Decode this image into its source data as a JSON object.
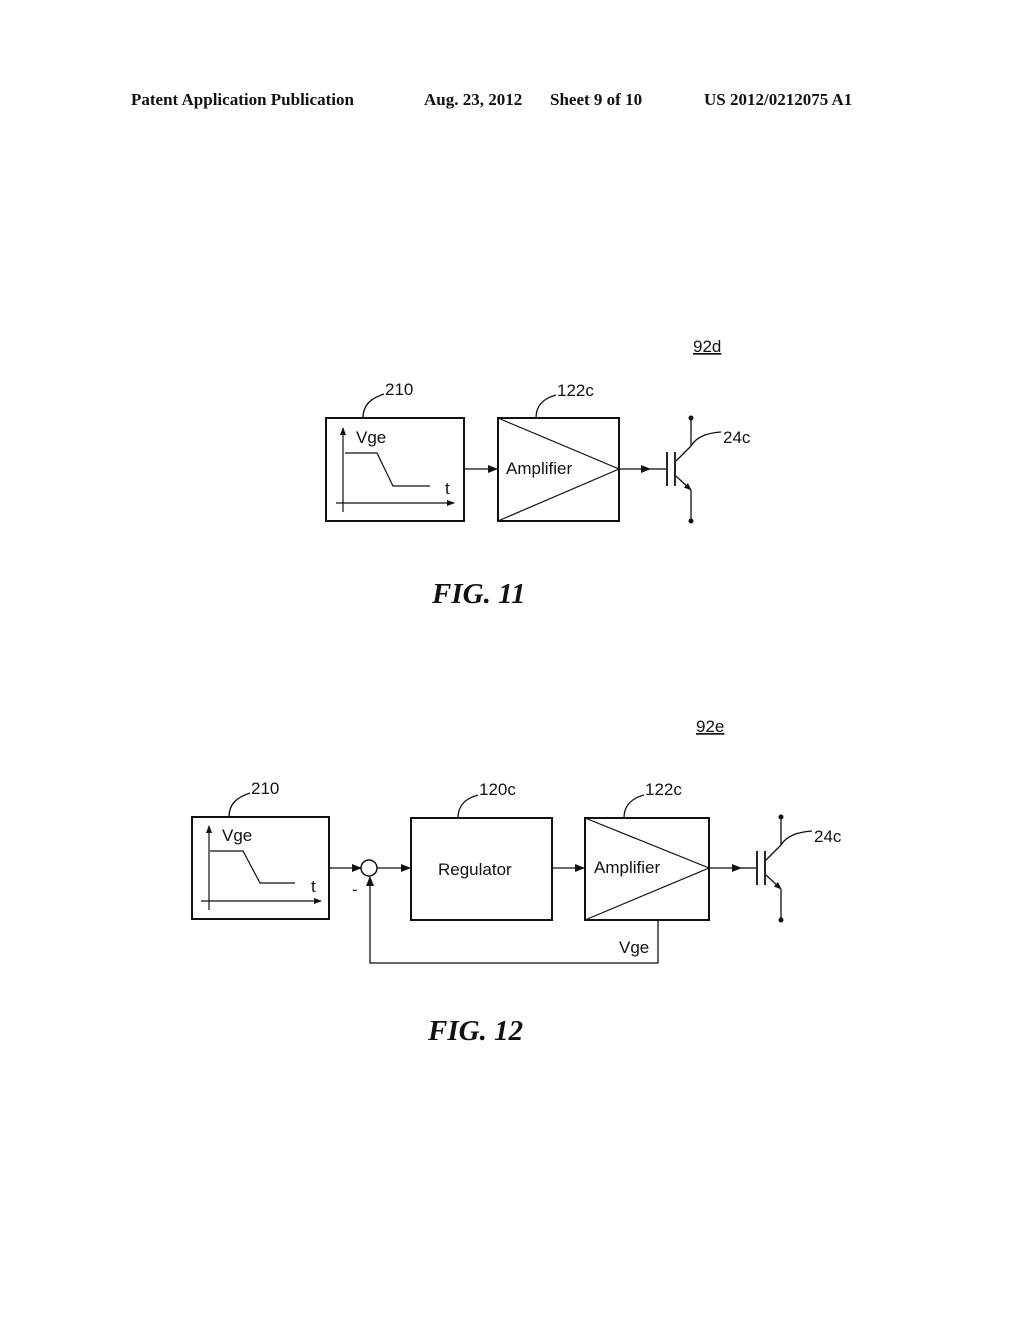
{
  "header": {
    "publication": "Patent Application Publication",
    "date": "Aug. 23, 2012",
    "sheet": "Sheet 9 of 10",
    "number": "US 2012/0212075 A1"
  },
  "fig11": {
    "ref": "92d",
    "caption": "FIG. 11",
    "generator": {
      "ref": "210",
      "y_label": "Vge",
      "x_label": "t"
    },
    "amplifier": {
      "ref": "122c",
      "label": "Amplifier"
    },
    "transistor": {
      "ref": "24c"
    }
  },
  "fig12": {
    "ref": "92e",
    "caption": "FIG. 12",
    "generator": {
      "ref": "210",
      "y_label": "Vge",
      "x_label": "t"
    },
    "summing_sign": "-",
    "regulator": {
      "ref": "120c",
      "label": "Regulator"
    },
    "amplifier": {
      "ref": "122c",
      "label": "Amplifier"
    },
    "feedback_label": "Vge",
    "transistor": {
      "ref": "24c"
    }
  }
}
